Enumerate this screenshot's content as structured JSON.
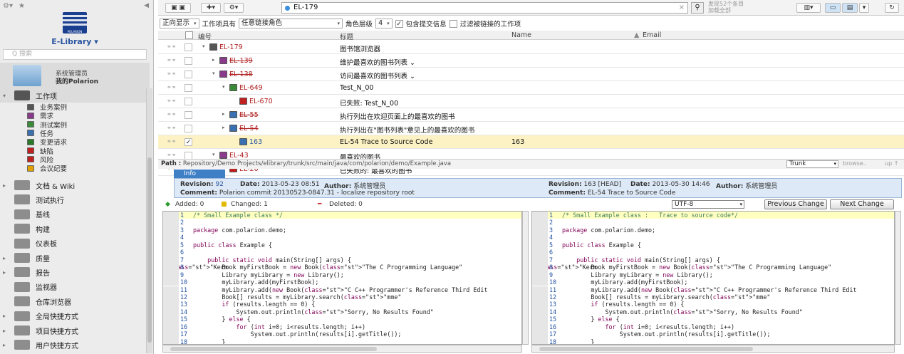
{
  "sidebar": {
    "library_title": "E-Library ▾",
    "logo_text": "POLARION",
    "search_placeholder": "Q 搜索",
    "user_name_line1": "系统管理员",
    "user_name_line2": "我的Polarion",
    "work_items_label": "工作项",
    "work_item_types": [
      "业务案例",
      "需求",
      "测试案例",
      "任务",
      "变更请求",
      "缺陷",
      "风险",
      "会议纪要"
    ],
    "sections": [
      "文档 & Wiki",
      "测试执行",
      "基线",
      "构建",
      "仪表板",
      "质量",
      "报告",
      "监视器",
      "仓库浏览器",
      "全局快捷方式",
      "项目快捷方式",
      "用户快捷方式"
    ]
  },
  "toolbar": {
    "query": "EL-179",
    "clear": "×",
    "found_line1": "发现52个条目",
    "found_line2": "加载全部"
  },
  "filter": {
    "mode": "正向显示",
    "has_label": "工作项具有",
    "link_role": "任意链接角色",
    "level_label": "角色层级",
    "level_value": "4",
    "include_commits": "包含提交信息",
    "filter_linked": "过滤被链接的工作项"
  },
  "table": {
    "headers": {
      "id": "编号",
      "title": "标题",
      "name": "Name",
      "email": "Email"
    },
    "rows": [
      {
        "id": "EL-179",
        "title": "图书馆浏览器",
        "name": "",
        "checked": false,
        "struck": false
      },
      {
        "id": "EL-139",
        "title": "维护最喜欢的图书列表 ⌄",
        "name": "",
        "checked": false,
        "struck": true
      },
      {
        "id": "EL-138",
        "title": "访问最喜欢的图书列表 ⌄",
        "name": "",
        "checked": false,
        "struck": true
      },
      {
        "id": "EL-649",
        "title": "Test_N_00",
        "name": "",
        "checked": false,
        "struck": false
      },
      {
        "id": "EL-670",
        "title": "已失败: Test_N_00",
        "name": "",
        "checked": false,
        "struck": false
      },
      {
        "id": "EL-55",
        "title": "执行列出在欢迎页面上的最喜欢的图书",
        "name": "",
        "checked": false,
        "struck": true
      },
      {
        "id": "EL-54",
        "title": "执行列出在\"图书列表\"意见上的最喜欢的图书",
        "name": "",
        "checked": false,
        "struck": true
      },
      {
        "id": "163",
        "title": "EL-54 Trace to Source Code",
        "name": "163",
        "checked": true,
        "struck": false
      },
      {
        "id": "EL-43",
        "title": "最喜欢的图书",
        "name": "",
        "checked": false,
        "struck": false
      },
      {
        "id": "EL-20",
        "title": "已失败的: 最喜欢的图书",
        "name": "",
        "checked": false,
        "struck": false
      }
    ]
  },
  "diff": {
    "path_label": "Path :",
    "path": "Repository/Demo Projects/elibrary/trunk/src/main/java/com/polarion/demo/Example.java",
    "branch": "Trunk",
    "browse": "browse..",
    "up": "up ↑",
    "info_tab": "Info",
    "left": {
      "revision_label": "Revision:",
      "revision": "92",
      "date_label": "Date:",
      "date": "2013-05-23 08:51",
      "author_label": "Author:",
      "author": "系统管理员",
      "comment_label": "Comment:",
      "comment": "Polarion commit 20130523-0847.31 - localize repository root"
    },
    "right": {
      "revision_label": "Revision:",
      "revision": "163 [HEAD]",
      "date_label": "Date:",
      "date": "2013-05-30 14:46",
      "author_label": "Author:",
      "author": "系统管理员",
      "comment_label": "Comment:",
      "comment": "EL-54 Trace to Source Code"
    },
    "added": "Added: 0",
    "changed": "Changed: 1",
    "deleted": "Deleted: 0",
    "encoding": "UTF-8",
    "prev_btn": "Previous Change",
    "next_btn": "Next Change",
    "left_code": [
      "/* Small Example class */",
      "",
      "package com.polarion.demo;",
      "",
      "public class Example {",
      "",
      "    public static void main(String[] args) {",
      "        Book myFirstBook = new Book(\"The C Programming Language\", \"Kern",
      "        Library myLibrary = new Library();",
      "        myLibrary.add(myFirstBook);",
      "        myLibrary.add(new Book(\"C C++ Programmer's Reference Third Edit",
      "        Book[] results = myLibrary.search(\"mme\");",
      "        if (results.length == 0) {",
      "            System.out.println(\"Sorry, No Results Found\");",
      "        } else {",
      "            for (int i=0; i<results.length; i++)",
      "                System.out.println(results[i].getTitle());",
      "        }"
    ],
    "right_code": [
      "/* Small Example class :   Trace to source code*/",
      "",
      "package com.polarion.demo;",
      "",
      "public class Example {",
      "",
      "    public static void main(String[] args) {",
      "        Book myFirstBook = new Book(\"The C Programming Language\", \"Kern",
      "        Library myLibrary = new Library();",
      "        myLibrary.add(myFirstBook);",
      "        myLibrary.add(new Book(\"C C++ Programmer's Reference Third Edit",
      "        Book[] results = myLibrary.search(\"mme\");",
      "        if (results.length == 0) {",
      "            System.out.println(\"Sorry, No Results Found\");",
      "        } else {",
      "            for (int i=0; i<results.length; i++)",
      "                System.out.println(results[i].getTitle());",
      "        }"
    ]
  },
  "colors": {
    "accent": "#3f7fc6",
    "link_red": "#b02020",
    "highlight": "#ffffc0",
    "selected_row": "#fdf2c4"
  }
}
